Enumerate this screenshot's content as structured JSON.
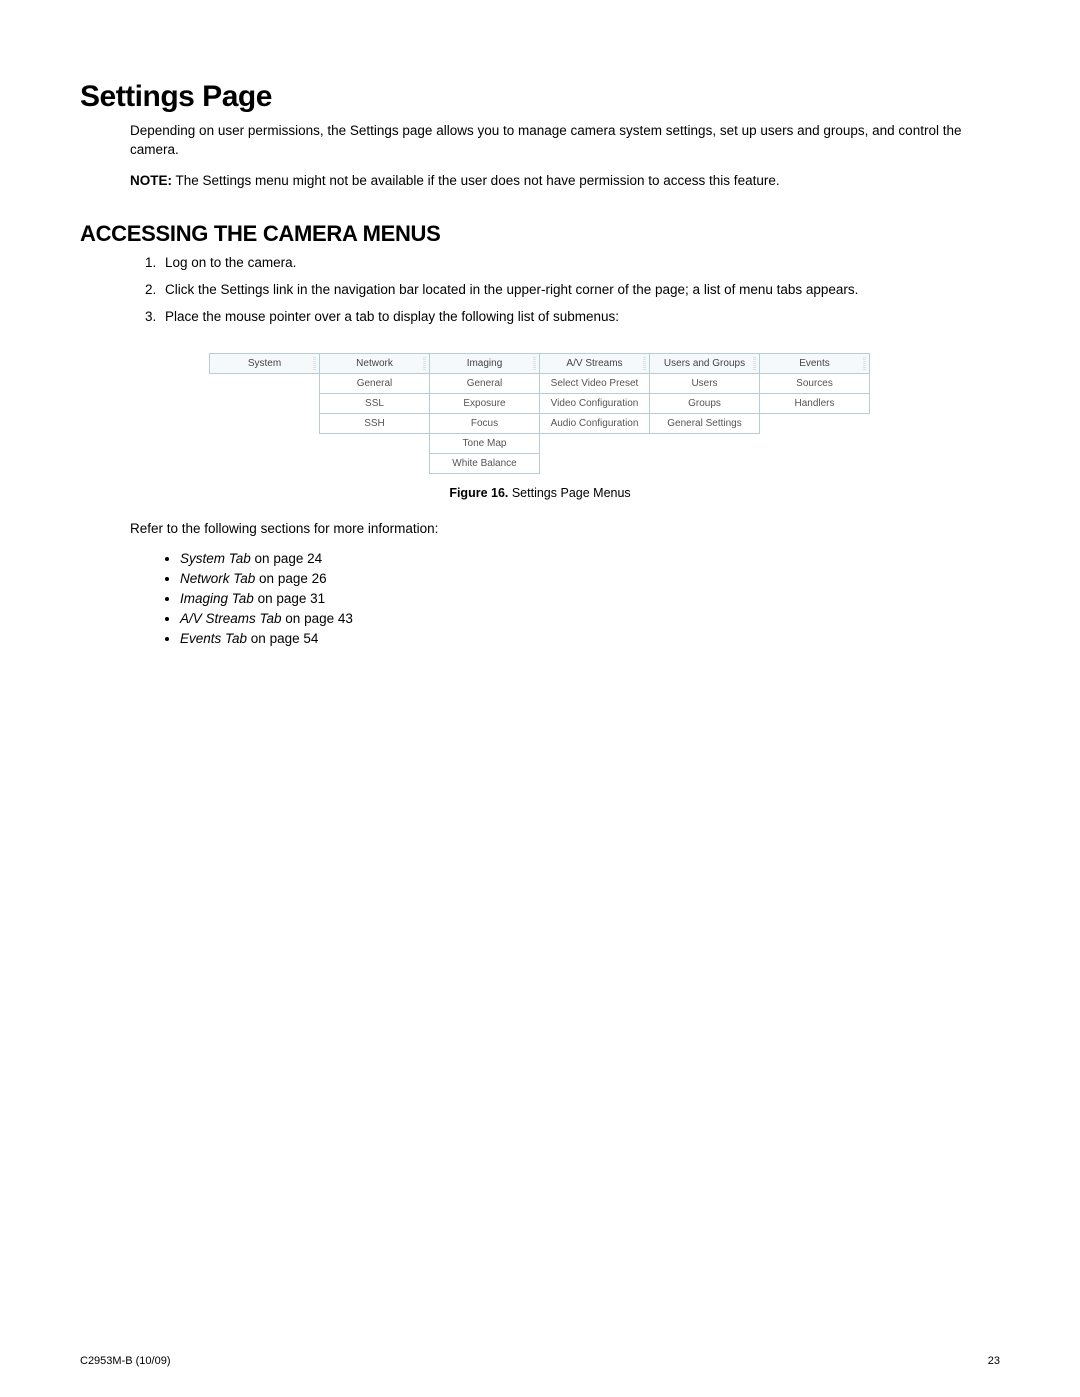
{
  "title": "Settings Page",
  "intro": "Depending on user permissions, the Settings page allows you to manage camera system settings, set up users and groups, and control the camera.",
  "note_label": "NOTE:",
  "note_text": " The Settings menu might not be available if the user does not have permission to access this feature.",
  "section_heading": "ACCESSING THE CAMERA MENUS",
  "steps": [
    "Log on to the camera.",
    "Click the Settings link in the navigation bar located in the upper-right corner of the page; a list of menu tabs appears.",
    "Place the mouse pointer over a tab to display the following list of submenus:"
  ],
  "menu_columns": [
    {
      "header": "System",
      "items": []
    },
    {
      "header": "Network",
      "items": [
        "General",
        "SSL",
        "SSH"
      ]
    },
    {
      "header": "Imaging",
      "items": [
        "General",
        "Exposure",
        "Focus",
        "Tone Map",
        "White Balance"
      ]
    },
    {
      "header": "A/V Streams",
      "items": [
        "Select Video Preset",
        "Video Configuration",
        "Audio Configuration"
      ]
    },
    {
      "header": "Users and Groups",
      "items": [
        "Users",
        "Groups",
        "General Settings"
      ]
    },
    {
      "header": "Events",
      "items": [
        "Sources",
        "Handlers"
      ]
    }
  ],
  "figure_label": "Figure 16.",
  "figure_caption": "  Settings Page Menus",
  "refer_text": "Refer to the following sections for more information:",
  "refs": [
    {
      "title": "System Tab",
      "suffix": " on page 24"
    },
    {
      "title": "Network Tab",
      "suffix": " on page 26"
    },
    {
      "title": "Imaging Tab",
      "suffix": " on page 31"
    },
    {
      "title": "A/V Streams Tab",
      "suffix": " on page 43"
    },
    {
      "title": "Events Tab",
      "suffix": " on page 54"
    }
  ],
  "footer_left": "C2953M-B (10/09)",
  "footer_right": "23"
}
